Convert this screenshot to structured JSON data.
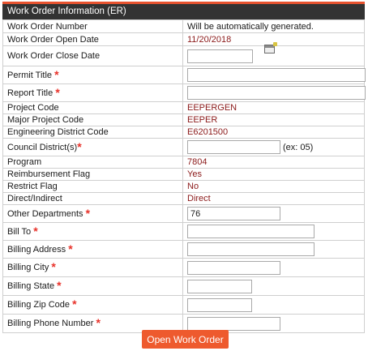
{
  "panel": {
    "title": "Work Order Information (ER)"
  },
  "fields": {
    "work_order_number": {
      "label": "Work Order Number",
      "value": "Will be automatically generated."
    },
    "open_date": {
      "label": "Work Order Open Date",
      "value": "11/20/2018"
    },
    "close_date": {
      "label": "Work Order Close Date",
      "value": ""
    },
    "permit_title": {
      "label": "Permit Title",
      "value": ""
    },
    "report_title": {
      "label": "Report Title",
      "value": ""
    },
    "project_code": {
      "label": "Project Code",
      "value": "EEPERGEN"
    },
    "major_project_code": {
      "label": "Major Project Code",
      "value": "EEPER"
    },
    "engineering_district_code": {
      "label": "Engineering District Code",
      "value": "E6201500"
    },
    "council_districts": {
      "label": "Council District(s)",
      "value": "",
      "hint": "(ex: 05)"
    },
    "program": {
      "label": "Program",
      "value": "7804"
    },
    "reimbursement_flag": {
      "label": "Reimbursement Flag",
      "value": "Yes"
    },
    "restrict_flag": {
      "label": "Restrict Flag",
      "value": "No"
    },
    "direct_indirect": {
      "label": "Direct/Indirect",
      "value": "Direct"
    },
    "other_departments": {
      "label": "Other Departments",
      "value": "76"
    },
    "bill_to": {
      "label": "Bill To",
      "value": ""
    },
    "billing_address": {
      "label": "Billing Address",
      "value": ""
    },
    "billing_city": {
      "label": "Billing City",
      "value": ""
    },
    "billing_state": {
      "label": "Billing State",
      "value": ""
    },
    "billing_zip": {
      "label": "Billing Zip Code",
      "value": ""
    },
    "billing_phone": {
      "label": "Billing Phone Number",
      "value": ""
    }
  },
  "required_marker": "*",
  "actions": {
    "submit_label": "Open Work Order"
  },
  "colors": {
    "header_bg": "#333333",
    "accent": "#e8532f",
    "value_text": "#8b1a1a",
    "required": "#e8322a",
    "button": "#ee5a2e"
  },
  "icons": {
    "calendar": "calendar-icon"
  }
}
